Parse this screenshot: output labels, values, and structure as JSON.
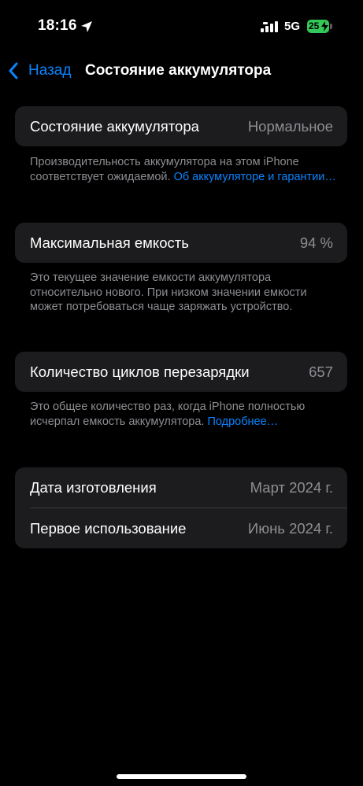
{
  "status_bar": {
    "time": "18:16",
    "network": "5G",
    "battery_percent": "25"
  },
  "nav": {
    "back_label": "Назад",
    "title": "Состояние аккумулятора"
  },
  "battery_health": {
    "label": "Состояние аккумулятора",
    "value": "Нормальное",
    "note_text": "Производительность аккумулятора на этом iPhone соответствует ожидаемой.",
    "note_link": "Об аккумуляторе и гарантии…"
  },
  "max_capacity": {
    "label": "Максимальная емкость",
    "value": "94 %",
    "note_text": "Это текущее значение емкости аккумулятора относительно нового. При низком значении емкости может потребоваться чаще заряжать устройство."
  },
  "cycle_count": {
    "label": "Количество циклов перезарядки",
    "value": "657",
    "note_text": "Это общее количество раз, когда iPhone полностью исчерпал емкость аккумулятора.",
    "note_link": "Подробнее…"
  },
  "dates": {
    "manufacture_label": "Дата изготовления",
    "manufacture_value": "Март 2024 г.",
    "first_use_label": "Первое использование",
    "first_use_value": "Июнь 2024 г."
  },
  "colors": {
    "accent": "#0a84ff",
    "card": "#1c1c1e",
    "secondary_text": "#8e8e93",
    "battery": "#34c759"
  },
  "icons": [
    "location-arrow-icon",
    "cellular-signal-icon",
    "battery-icon",
    "charging-bolt-icon",
    "chevron-left-icon"
  ]
}
